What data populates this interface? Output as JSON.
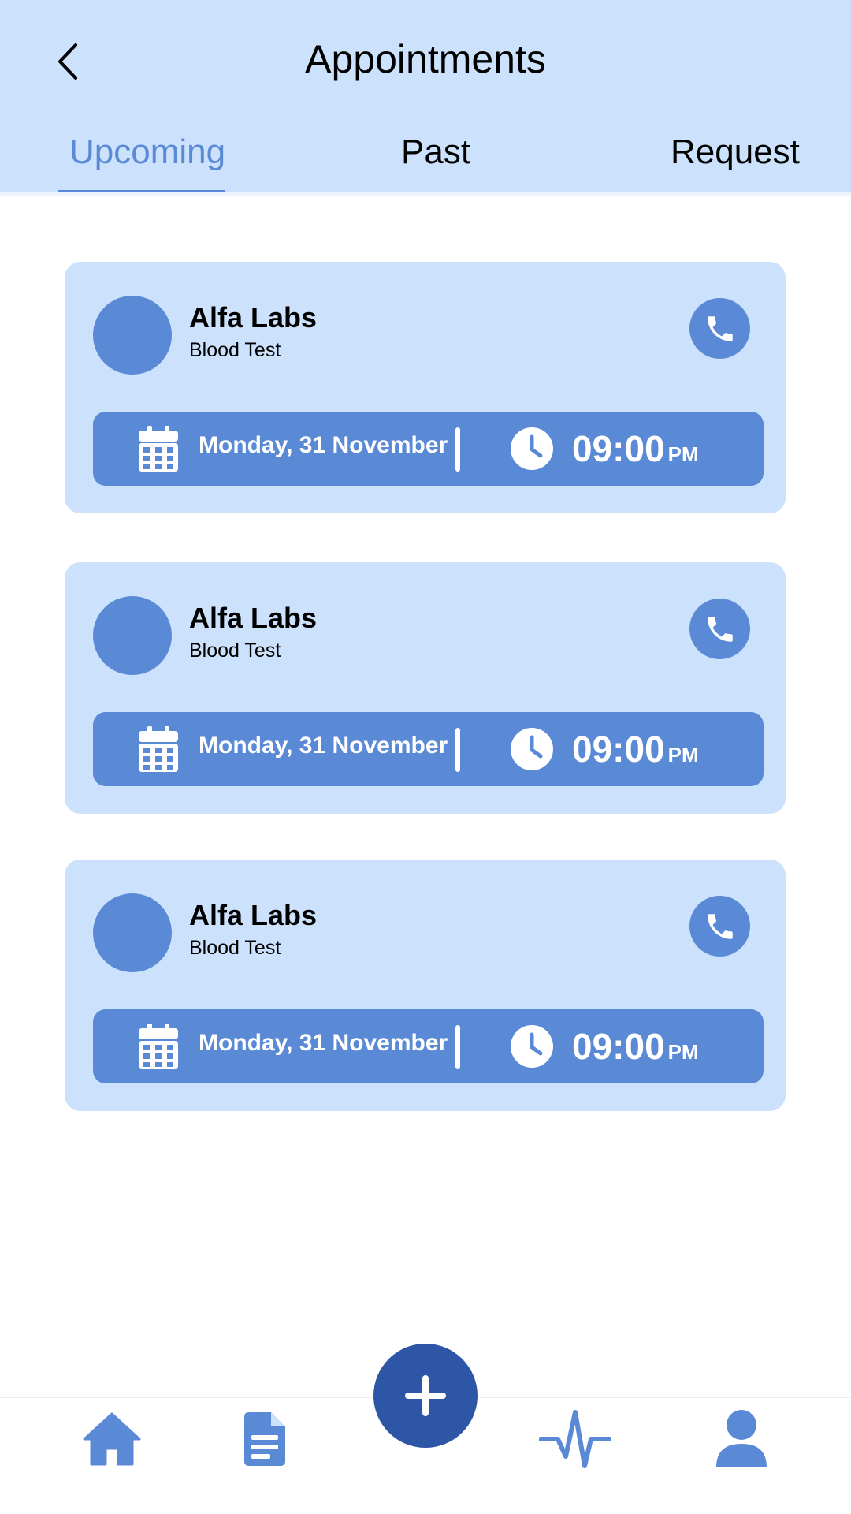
{
  "header": {
    "title": "Appointments",
    "back_icon": "chevron-left-icon",
    "tabs": [
      {
        "label": "Upcoming",
        "active": true
      },
      {
        "label": "Past",
        "active": false
      },
      {
        "label": "Request",
        "active": false
      }
    ]
  },
  "appointments": [
    {
      "lab": "Alfa Labs",
      "service": "Blood Test",
      "date": "Monday, 31 November",
      "time": "09:00",
      "ampm": "PM"
    },
    {
      "lab": "Alfa Labs",
      "service": "Blood Test",
      "date": "Monday, 31 November",
      "time": "09:00",
      "ampm": "PM"
    },
    {
      "lab": "Alfa Labs",
      "service": "Blood Test",
      "date": "Monday, 31 November",
      "time": "09:00",
      "ampm": "PM"
    }
  ],
  "bottom_nav": {
    "items": [
      "home-icon",
      "document-icon",
      "add-icon",
      "activity-icon",
      "profile-icon"
    ]
  },
  "colors": {
    "header_bg": "#cce1fc",
    "accent": "#5a8ad6",
    "fab": "#2e56a6"
  }
}
